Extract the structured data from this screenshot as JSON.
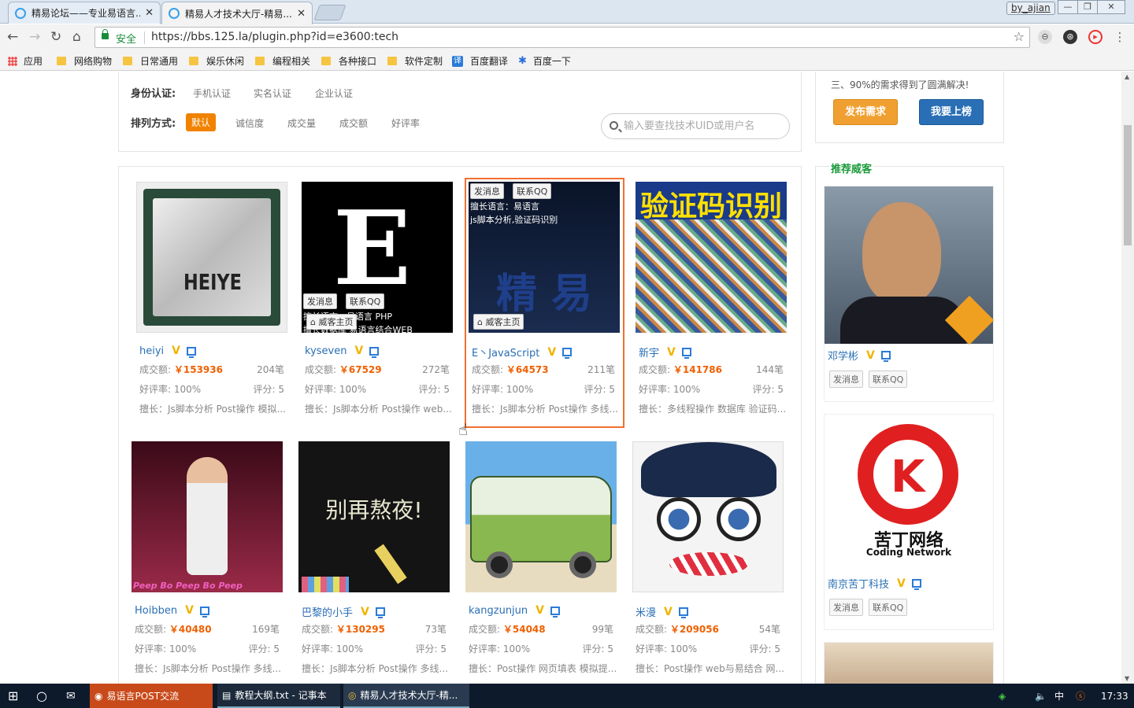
{
  "browser": {
    "tabs": [
      {
        "label": "精易论坛——专业易语言..."
      },
      {
        "label": "精易人才技术大厅-精易..."
      }
    ],
    "profile": "by_ajian",
    "window_controls": {
      "minimize": "—",
      "restore": "❐",
      "close": "✕"
    },
    "secure_label": "安全",
    "url": "https://bbs.125.la/plugin.php?id=e3600:tech",
    "bookmarks": [
      {
        "label": "应用"
      },
      {
        "label": "网络购物"
      },
      {
        "label": "日常通用"
      },
      {
        "label": "娱乐休闲"
      },
      {
        "label": "编程相关"
      },
      {
        "label": "各种接口"
      },
      {
        "label": "软件定制"
      },
      {
        "label": "百度翻译"
      },
      {
        "label": "百度一下"
      }
    ]
  },
  "filters": {
    "identity_label": "身份认证:",
    "identity_options": [
      "手机认证",
      "实名认证",
      "企业认证"
    ],
    "sort_label": "排列方式:",
    "sort_options": [
      "默认",
      "诚信度",
      "成交量",
      "成交额",
      "好评率"
    ],
    "search_placeholder": "输入要查找技术UID或用户名"
  },
  "labels": {
    "deal_amount": "成交额:",
    "good_rate": "好评率:",
    "score": "评分:",
    "speciality": "擅长:",
    "send_msg": "发消息",
    "contact_qq": "联系QQ",
    "home": "威客主页"
  },
  "cards": [
    {
      "name": "heiyi",
      "amount": "￥153936",
      "deals": "204笔",
      "rate": "100%",
      "score": "5",
      "skills": "擅长：Js脚本分析 Post操作 模拟...",
      "img_text": "HEIYE"
    },
    {
      "name": "kyseven",
      "amount": "￥67529",
      "deals": "272笔",
      "rate": "100%",
      "score": "5",
      "skills": "擅长：Js脚本分析 Post操作 web...",
      "overlay_line1": "擅长语言：易语言 PHP",
      "overlay_line2": "擅长数据库 易语言结合WEB"
    },
    {
      "name": "E丶JavaScript",
      "amount": "￥64573",
      "deals": "211笔",
      "rate": "100%",
      "score": "5",
      "skills": "擅长：Js脚本分析 Post操作 多线...",
      "overlay_line1": "擅长语言：易语言",
      "overlay_line2": "js脚本分析,验证码识别",
      "img_text": "精 易"
    },
    {
      "name": "新宇",
      "amount": "￥141786",
      "deals": "144笔",
      "rate": "100%",
      "score": "5",
      "skills": "擅长：多线程操作 数据库 验证码...",
      "img_text": "验证码识别"
    },
    {
      "name": "Hoibben",
      "amount": "￥40480",
      "deals": "169笔",
      "rate": "100%",
      "score": "5",
      "skills": "擅长：Js脚本分析 Post操作 多线...",
      "img_text": "Peep Bo Peep Bo Peep"
    },
    {
      "name": "巴黎的小手",
      "amount": "￥130295",
      "deals": "73笔",
      "rate": "100%",
      "score": "5",
      "skills": "擅长：Js脚本分析 Post操作 多线...",
      "img_text": "别再熬夜!"
    },
    {
      "name": "kangzunjun",
      "amount": "￥54048",
      "deals": "99笔",
      "rate": "100%",
      "score": "5",
      "skills": "擅长：Post操作 网页填表 模拟提..."
    },
    {
      "name": "米漫",
      "amount": "￥209056",
      "deals": "54笔",
      "rate": "100%",
      "score": "5",
      "skills": "擅长：Post操作 web与易结合 网..."
    }
  ],
  "sidebar": {
    "notice": "三、90%的需求得到了圆满解决!",
    "post_button": "发布需求",
    "rank_button": "我要上榜",
    "recommend_title": "推荐威客",
    "items": [
      {
        "name": "邓学彬"
      },
      {
        "name": "南京苦丁科技",
        "logo_text": "苦丁网络",
        "logo_sub": "Coding Network"
      }
    ]
  },
  "taskbar": {
    "items": [
      {
        "label": "易语言POST交流"
      },
      {
        "label": "教程大纲.txt - 记事本"
      },
      {
        "label": "精易人才技术大厅-精..."
      }
    ],
    "ime": "中",
    "tray_text": "ⓢ",
    "clock": "17:33"
  }
}
